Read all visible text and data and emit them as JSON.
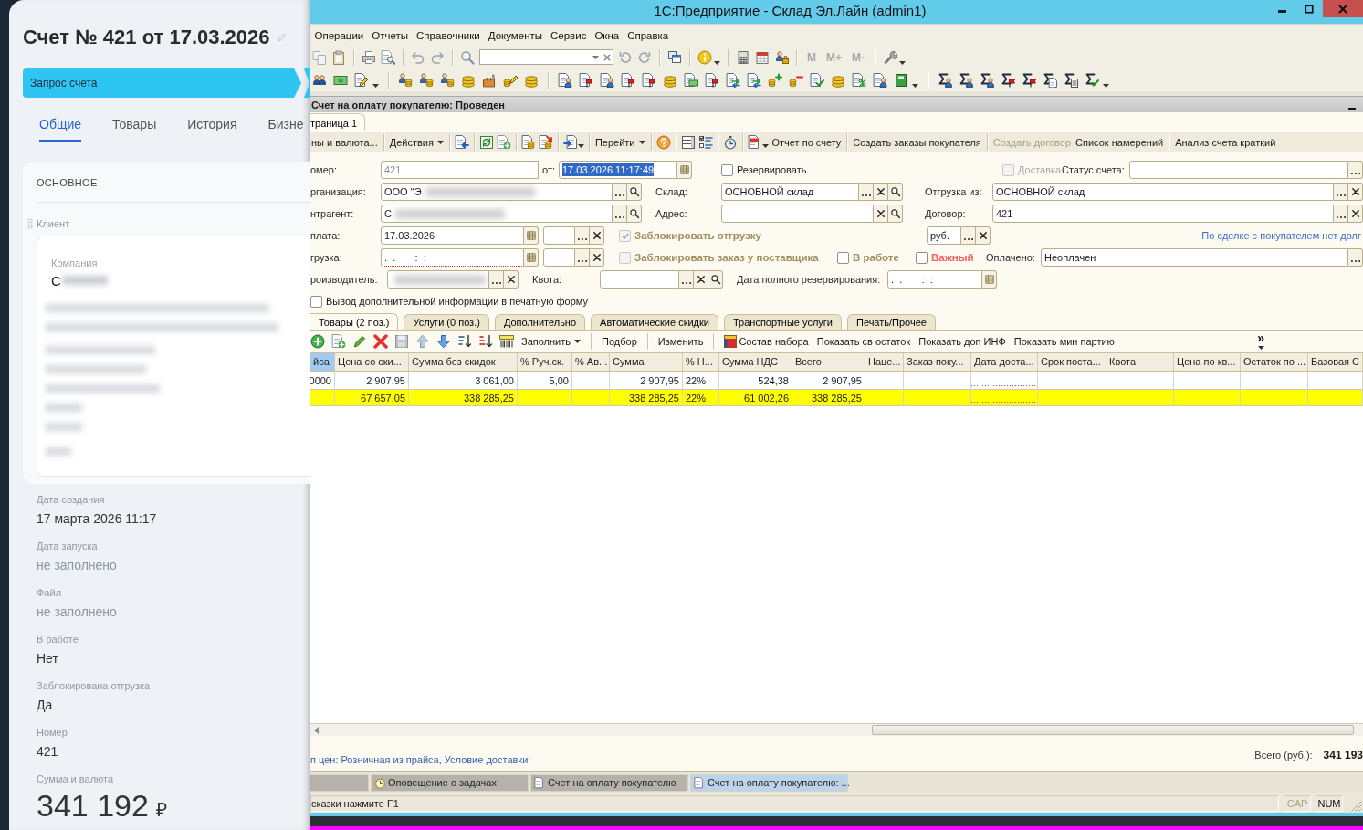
{
  "crm_panel": {
    "title": "Счет № 421 от 17.03.2026",
    "stage": {
      "label": "Запрос счета"
    },
    "tabs": [
      {
        "label": "Общие",
        "selected": true
      },
      {
        "label": "Товары",
        "selected": false
      },
      {
        "label": "История",
        "selected": false
      },
      {
        "label": "Бизне",
        "selected": false
      }
    ],
    "section": {
      "title": "ОСНОВНОЕ",
      "group": "Клиент",
      "company_label": "Компания",
      "company_value": "С",
      "company_redacted": true,
      "details_redacted": true
    },
    "fields": [
      {
        "label": "Дата создания",
        "value": "17 марта 2026 11:17",
        "filled": true
      },
      {
        "label": "Дата запуска",
        "value": "не заполнено",
        "filled": false
      },
      {
        "label": "Файл",
        "value": "не заполнено",
        "filled": false
      },
      {
        "label": "В работе",
        "value": "Нет",
        "filled": true
      },
      {
        "label": "Заблокирована отгрузка",
        "value": "Да",
        "filled": true
      },
      {
        "label": "Номер",
        "value": "421",
        "filled": true
      }
    ],
    "total": {
      "label": "Сумма и валюта",
      "value": "341 192",
      "currency": "₽"
    }
  },
  "app_window": {
    "title": "1С:Предприятие - Склад Эл.Лайн (admin1)",
    "menu": [
      "Операции",
      "Отчеты",
      "Справочники",
      "Документы",
      "Сервис",
      "Окна",
      "Справка"
    ],
    "memory_buttons": [
      {
        "label": "M",
        "disabled": true
      },
      {
        "label": "M+",
        "disabled": true
      },
      {
        "label": "M-",
        "disabled": true
      }
    ],
    "document": {
      "title": "Счет на оплату покупателю: Проведен",
      "page_tabs": [
        {
          "label": "траница 1",
          "selected": true
        }
      ],
      "command_bar": {
        "prices": "ны и валюта...",
        "actions_menu": "Действия",
        "goto_menu": "Перейти",
        "command_groups": [
          [
            {
              "label": "Отчет по счету",
              "disabled": false
            }
          ],
          [
            {
              "label": "Создать заказы покупателя",
              "disabled": false
            }
          ],
          [
            {
              "label": "Создать договор",
              "disabled": true
            },
            {
              "label": "Список намерений",
              "disabled": false
            }
          ],
          [
            {
              "label": "Анализ счета краткий",
              "disabled": false
            }
          ]
        ]
      },
      "form": {
        "number": {
          "label": "омер:",
          "value": "421",
          "disabled": true
        },
        "date": {
          "label": "от:",
          "value": "17.03.2026 11:17:49",
          "text_selected": true
        },
        "reserve": {
          "label": "Резервировать",
          "checked": false,
          "disabled": false
        },
        "delivery": {
          "label": "Доставка",
          "checked": false,
          "disabled": true
        },
        "invoice_status": {
          "label": "Статус счета:"
        },
        "organization": {
          "label": "рганизация:",
          "value": "ООО \"Э",
          "redacted": true
        },
        "warehouse": {
          "label": "Склад:",
          "value": "ОСНОВНОЙ склад"
        },
        "ship_from": {
          "label": "Отгрузка из:",
          "value": "ОСНОВНОЙ склад"
        },
        "counterparty": {
          "label": "нтрагент:",
          "value": "С",
          "redacted": true
        },
        "address": {
          "label": "Адрес:"
        },
        "contract": {
          "label": "Договор:",
          "value": "421"
        },
        "payment": {
          "label": "плата:",
          "value": "17.03.2026"
        },
        "block_shipment": {
          "label": "Заблокировать отгрузку",
          "checked": true,
          "disabled": true
        },
        "currency": {
          "value": "руб."
        },
        "debt_note": {
          "label": "По сделке с покупателем нет долг"
        },
        "shipment": {
          "label": "грузка:",
          "value": ".  .       :  :",
          "required": true
        },
        "block_supplier_order": {
          "label": "Заблокировать заказ у поставщика",
          "checked": false,
          "disabled": true
        },
        "in_work": {
          "label": "В работе",
          "checked": false,
          "disabled": false
        },
        "important": {
          "label": "Важный",
          "checked": false,
          "disabled": false
        },
        "paid": {
          "label": "Оплачено:",
          "value": "Неоплачен"
        },
        "producer": {
          "label": "роизводитель:",
          "redacted": true
        },
        "quota": {
          "label": "Квота:"
        },
        "full_reserve_date": {
          "label": "Дата полного резервирования:",
          "value": ".  .       :  :"
        },
        "print_info": {
          "label": "Вывод дополнительной информации в печатную форму",
          "checked": false,
          "disabled": false
        }
      },
      "item_tabs": [
        {
          "label": "Товары (2 поз.)",
          "selected": true
        },
        {
          "label": "Услуги (0 поз.)",
          "selected": false
        },
        {
          "label": "Дополнительно",
          "selected": false
        },
        {
          "label": "Автоматические скидки",
          "selected": false
        },
        {
          "label": "Транспортные услуги",
          "selected": false
        },
        {
          "label": "Печать/Прочее",
          "selected": false
        }
      ],
      "table_toolbar": {
        "fill_menu": "Заполнить",
        "groups": [
          [
            {
              "label": "Подбор",
              "kind": "text"
            }
          ],
          [
            {
              "label": "Изменить",
              "kind": "text"
            }
          ],
          [
            {
              "label": "Состав набора",
              "kind": "icon_text"
            },
            {
              "label": "Показать св остаток",
              "kind": "text"
            },
            {
              "label": "Показать доп ИНФ",
              "kind": "text"
            },
            {
              "label": "Показать мин партию",
              "kind": "text"
            }
          ]
        ],
        "more": "»"
      },
      "table": {
        "columns": [
          {
            "label": "йса",
            "kind": "number",
            "selected": true,
            "required": false
          },
          {
            "label": "Цена со ски...",
            "kind": "number",
            "selected": false,
            "required": false
          },
          {
            "label": "Сумма без скидок",
            "kind": "number",
            "selected": false,
            "required": false
          },
          {
            "label": "% Руч.ск.",
            "kind": "number",
            "selected": false,
            "required": false
          },
          {
            "label": "% Ав...",
            "kind": "number",
            "selected": false,
            "required": false
          },
          {
            "label": "Сумма",
            "kind": "number",
            "selected": false,
            "required": false
          },
          {
            "label": "% Н...",
            "kind": "text",
            "selected": false,
            "required": false
          },
          {
            "label": "Сумма НДС",
            "kind": "number",
            "selected": false,
            "required": false
          },
          {
            "label": "Всего",
            "kind": "number",
            "selected": false,
            "required": false
          },
          {
            "label": "Наце...",
            "kind": "number",
            "selected": false,
            "required": false
          },
          {
            "label": "Заказ поку...",
            "kind": "text",
            "selected": false,
            "required": false
          },
          {
            "label": "Дата доста...",
            "kind": "text",
            "selected": false,
            "required": true
          },
          {
            "label": "Срок поста...",
            "kind": "text",
            "selected": false,
            "required": false
          },
          {
            "label": "Квота",
            "kind": "text",
            "selected": false,
            "required": false
          },
          {
            "label": "Цена по кв...",
            "kind": "number",
            "selected": false,
            "required": false
          },
          {
            "label": "Остаток по ...",
            "kind": "number",
            "selected": false,
            "required": false
          },
          {
            "label": "Базовая С",
            "kind": "number",
            "selected": false,
            "required": false
          }
        ],
        "rows": [
          {
            "highlighted": false,
            "cells": [
              "0000",
              "2 907,95",
              "3 061,00",
              "5,00",
              null,
              "2 907,95",
              "22%",
              "524,38",
              "2 907,95",
              null,
              null,
              null,
              null,
              null,
              null,
              null,
              null
            ]
          },
          {
            "highlighted": true,
            "cells": [
              null,
              "67 657,05",
              "338 285,25",
              null,
              null,
              "338 285,25",
              "22%",
              "61 002,26",
              "338 285,25",
              null,
              null,
              null,
              null,
              null,
              null,
              null,
              null
            ]
          }
        ]
      },
      "footer": {
        "price_info": "п цен: Розничная из прайса, Условие доставки:",
        "total_label": "Всего (руб.):",
        "total_value": "341 193"
      }
    },
    "window_tabs": [
      {
        "label": "Оповещение о задачах",
        "kind": "alert",
        "selected": false
      },
      {
        "label": "Счет на оплату покупателю",
        "kind": "document",
        "selected": false
      },
      {
        "label": "Счет на оплату покупателю: ...",
        "kind": "document",
        "selected": true
      }
    ],
    "status_bar": {
      "hint": "сказки нажмите F1",
      "indicators": [
        {
          "label": "CAP",
          "on": false
        },
        {
          "label": "NUM",
          "on": true
        }
      ]
    }
  }
}
